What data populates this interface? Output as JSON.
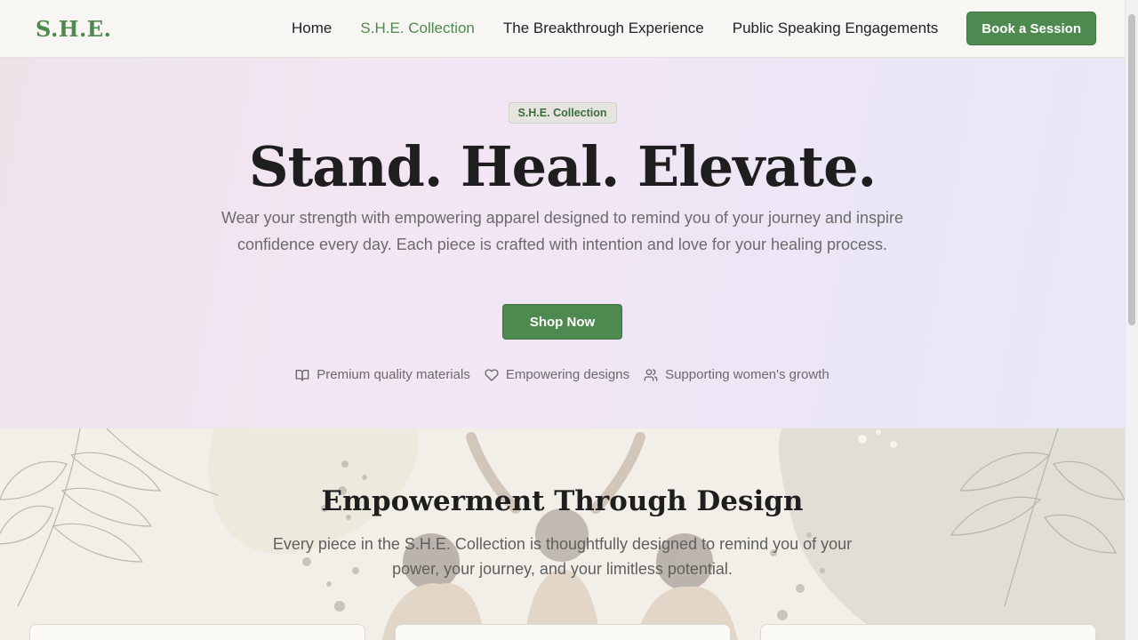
{
  "nav": {
    "logo": "S.H.E.",
    "links": [
      {
        "label": "Home",
        "active": false
      },
      {
        "label": "S.H.E. Collection",
        "active": true
      },
      {
        "label": "The Breakthrough Experience",
        "active": false
      },
      {
        "label": "Public Speaking Engagements",
        "active": false
      }
    ],
    "cta": "Book a Session"
  },
  "hero": {
    "badge": "S.H.E. Collection",
    "title": "Stand. Heal. Elevate.",
    "subtitle": "Wear your strength with empowering apparel designed to remind you of your journey and inspire confidence every day. Each piece is crafted with intention and love for your healing process.",
    "cta": "Shop Now",
    "features": [
      {
        "icon": "book-open-icon",
        "label": "Premium quality materials"
      },
      {
        "icon": "heart-icon",
        "label": "Empowering designs"
      },
      {
        "icon": "users-icon",
        "label": "Supporting women's growth"
      }
    ]
  },
  "section": {
    "title": "Empowerment Through Design",
    "subtitle": "Every piece in the S.H.E. Collection is thoughtfully designed to remind you of your power, your journey, and your limitless potential."
  },
  "colors": {
    "brand_green": "#4e8a4f",
    "hero_bg": "#f3e6f4",
    "section_bg": "#f1efe7"
  }
}
